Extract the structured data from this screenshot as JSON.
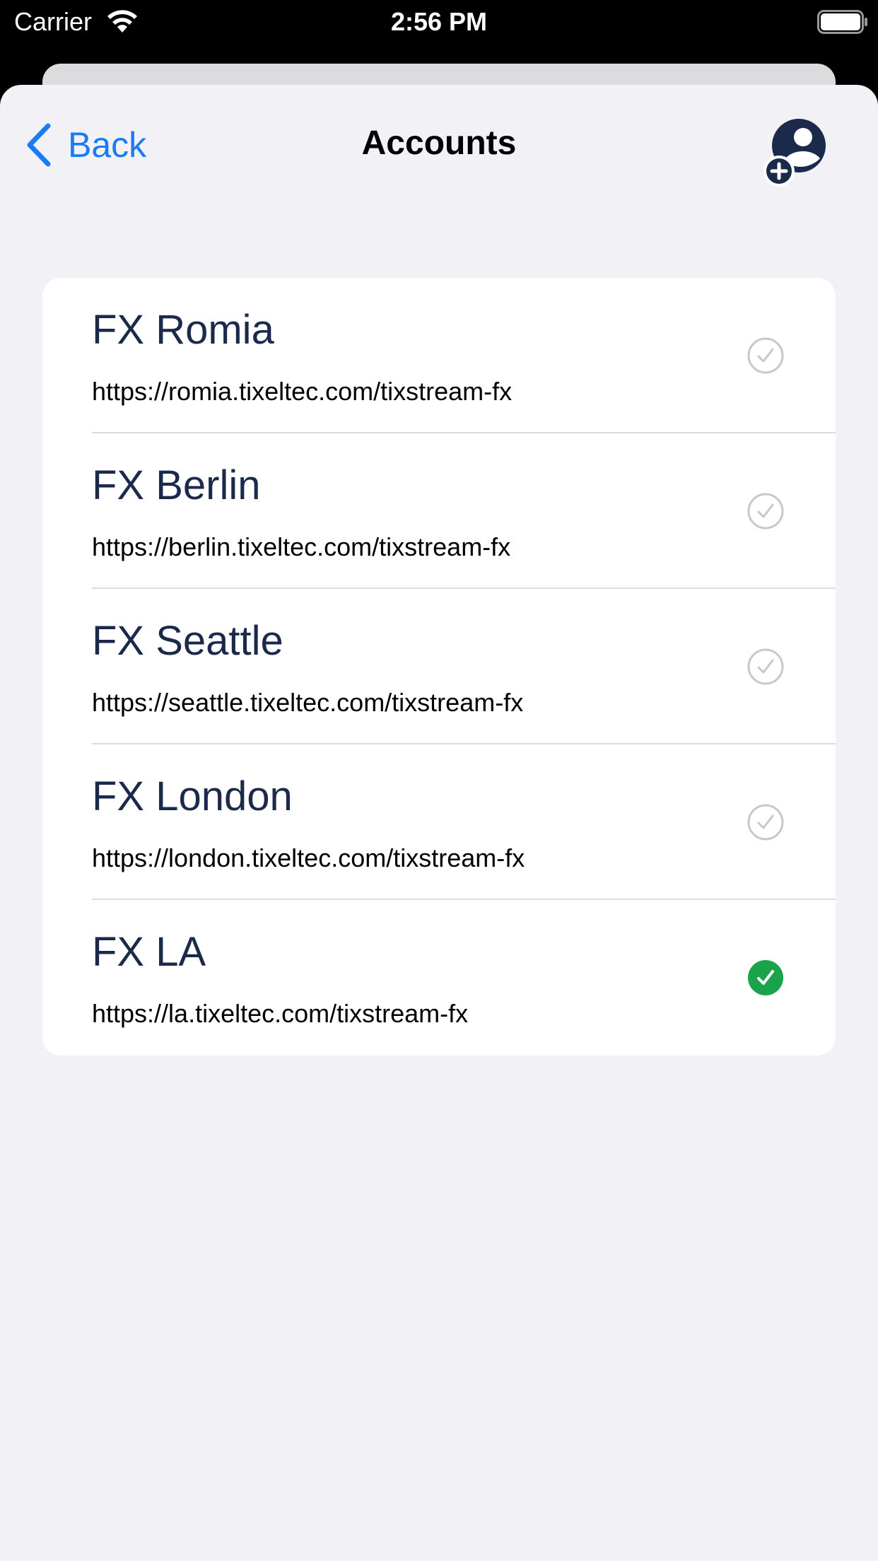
{
  "status_bar": {
    "carrier": "Carrier",
    "time": "2:56 PM",
    "wifi_icon": "wifi-icon",
    "battery_icon": "battery-icon"
  },
  "nav": {
    "back_label": "Back",
    "back_icon": "chevron-left-icon",
    "title": "Accounts",
    "add_icon": "add-user-icon"
  },
  "accounts": [
    {
      "name": "FX Romia",
      "url": "https://romia.tixeltec.com/tixstream-fx",
      "selected": false
    },
    {
      "name": "FX Berlin",
      "url": "https://berlin.tixeltec.com/tixstream-fx",
      "selected": false
    },
    {
      "name": "FX Seattle",
      "url": "https://seattle.tixeltec.com/tixstream-fx",
      "selected": false
    },
    {
      "name": "FX London",
      "url": "https://london.tixeltec.com/tixstream-fx",
      "selected": false
    },
    {
      "name": "FX LA",
      "url": "https://la.tixeltec.com/tixstream-fx",
      "selected": true
    }
  ],
  "colors": {
    "accent": "#1a7cf5",
    "navy": "#1b2a4a",
    "selected_check": "#1aa34a",
    "unselected_check": "#c7c7cc"
  }
}
